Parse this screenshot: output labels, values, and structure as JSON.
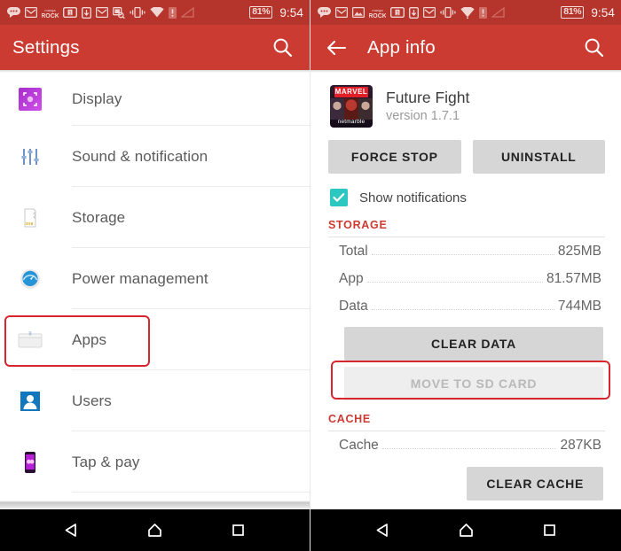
{
  "colors": {
    "status_bar": "#b5352d",
    "app_bar": "#cc3b32",
    "accent_red": "#cc3b32",
    "highlight_border": "#d8262e",
    "checkbox_teal": "#2cc7c0",
    "nav_bar": "#000000"
  },
  "left_phone": {
    "status_bar": {
      "icons": [
        "sms-icon",
        "gmail-icon",
        "mangarock-icon",
        "sim-card-icon",
        "file-transfer-icon",
        "gmail-icon",
        "screenshot-icon",
        "vibrate-icon",
        "wifi-icon",
        "warning-icon",
        "signal-icon"
      ],
      "battery_percent": "81%",
      "clock": "9:54"
    },
    "app_bar": {
      "title": "Settings",
      "search_icon": "search-icon"
    },
    "list": [
      {
        "label": "Display",
        "icon": "display-icon"
      },
      {
        "label": "Sound & notification",
        "icon": "sound-notification-icon"
      },
      {
        "label": "Storage",
        "icon": "storage-sdcard-icon"
      },
      {
        "label": "Power management",
        "icon": "power-management-icon"
      },
      {
        "label": "Apps",
        "icon": "apps-icon",
        "highlighted": true
      },
      {
        "label": "Users",
        "icon": "users-icon"
      },
      {
        "label": "Tap & pay",
        "icon": "tap-and-pay-icon"
      }
    ],
    "nav": [
      "back-button",
      "home-button",
      "recents-button"
    ]
  },
  "right_phone": {
    "status_bar": {
      "icons": [
        "sms-icon",
        "gmail-icon",
        "gallery-icon",
        "mangarock-icon",
        "sim-card-icon",
        "file-transfer-icon",
        "gmail-icon",
        "vibrate-icon",
        "wifi-icon",
        "warning-icon",
        "signal-icon"
      ],
      "battery_percent": "81%",
      "clock": "9:54"
    },
    "app_bar": {
      "back_icon": "arrow-back-icon",
      "title": "App info",
      "search_icon": "search-icon"
    },
    "app": {
      "icon_name": "future-fight-app-icon",
      "icon_brand": "MARVEL",
      "icon_publisher": "netmarble",
      "name": "Future Fight",
      "version": "version 1.7.1"
    },
    "actions": {
      "force_stop": "FORCE STOP",
      "uninstall": "UNINSTALL"
    },
    "notifications": {
      "label": "Show notifications",
      "checked": true,
      "check_icon": "checkmark-icon"
    },
    "storage": {
      "header": "STORAGE",
      "rows": [
        {
          "key": "Total",
          "value": "825MB"
        },
        {
          "key": "App",
          "value": "81.57MB"
        },
        {
          "key": "Data",
          "value": "744MB"
        }
      ],
      "clear_data": "CLEAR DATA",
      "move_to_sd": "MOVE TO SD CARD",
      "move_to_sd_disabled": true,
      "move_to_sd_highlighted": true
    },
    "cache": {
      "header": "CACHE",
      "rows": [
        {
          "key": "Cache",
          "value": "287KB"
        }
      ],
      "clear_cache": "CLEAR CACHE"
    },
    "nav": [
      "back-button",
      "home-button",
      "recents-button"
    ]
  }
}
